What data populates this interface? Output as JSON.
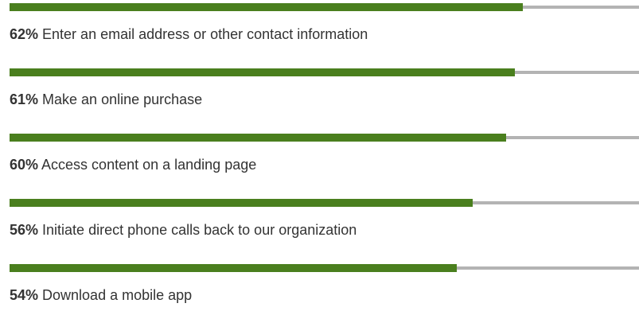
{
  "chart_data": {
    "type": "bar",
    "orientation": "horizontal",
    "categories": [
      "Enter an email address or other contact information",
      "Make an online purchase",
      "Access content on a landing page",
      "Initiate direct phone calls back to our organization",
      "Download a mobile app"
    ],
    "values": [
      62,
      61,
      60,
      56,
      54
    ],
    "value_labels": [
      "62%",
      "61%",
      "60%",
      "56%",
      "54%"
    ],
    "xlim": [
      0,
      100
    ],
    "grid": false,
    "legend": "none",
    "colors": {
      "fill": "#4a7f1e",
      "track": "#b3b3b3",
      "text": "#333333"
    }
  }
}
